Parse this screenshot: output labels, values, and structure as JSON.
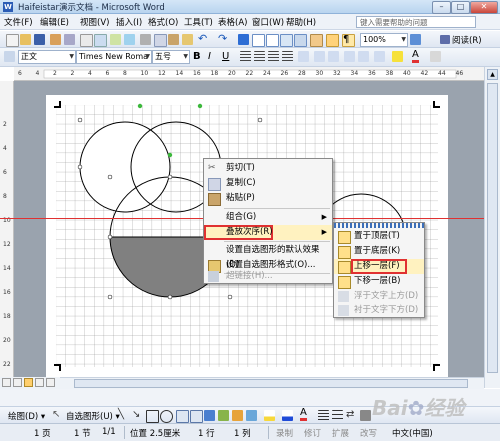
{
  "window": {
    "title": "Haifeistar演示文档 - Microsoft Word",
    "app_icon": "W",
    "minimize": "–",
    "maximize": "□",
    "close": "✕"
  },
  "menubar": {
    "items": [
      "文件(F)",
      "编辑(E)",
      "视图(V)",
      "插入(I)",
      "格式(O)",
      "工具(T)",
      "表格(A)",
      "窗口(W)",
      "帮助(H)"
    ],
    "help_placeholder": "键入需要帮助的问题"
  },
  "standard_toolbar": {
    "zoom": "100%",
    "reading_mode": "阅读(R)",
    "undo_icon": "undo-icon",
    "redo_icon": "redo-icon"
  },
  "format_toolbar": {
    "style": "正文",
    "font": "Times New Roma",
    "size": "五号",
    "bold": "B",
    "italic": "I",
    "underline": "U",
    "font_color_letter": "A"
  },
  "ruler": {
    "h_ticks": [
      "6",
      "4",
      "2",
      "2",
      "4",
      "6",
      "8",
      "10",
      "12",
      "14",
      "16",
      "18",
      "20",
      "22",
      "24",
      "26",
      "28",
      "30",
      "32",
      "34",
      "36",
      "38",
      "40",
      "42",
      "44",
      "46"
    ],
    "v_ticks": [
      "2",
      "4",
      "6",
      "8",
      "10",
      "12",
      "14",
      "16",
      "18",
      "20",
      "22"
    ]
  },
  "context_menu": {
    "items": [
      {
        "label": "剪切(T)",
        "icon": "scissors-icon",
        "disabled": false
      },
      {
        "label": "复制(C)",
        "icon": "copy-icon",
        "disabled": false
      },
      {
        "label": "粘贴(P)",
        "icon": "paste-icon",
        "disabled": false
      },
      {
        "label": "组合(G)",
        "icon": "",
        "disabled": false,
        "submenu": true
      },
      {
        "label": "叠放次序(R)",
        "icon": "",
        "disabled": false,
        "submenu": true,
        "highlighted": true
      },
      {
        "label": "设置自选图形的默认效果(D)",
        "icon": "",
        "disabled": false
      },
      {
        "label": "设置自选图形格式(O)...",
        "icon": "format-shape-icon",
        "disabled": false
      },
      {
        "label": "超链接(H)...",
        "icon": "hyperlink-icon",
        "disabled": true
      }
    ]
  },
  "submenu": {
    "items": [
      {
        "label": "置于顶层(T)",
        "icon": "bring-to-front-icon",
        "disabled": false
      },
      {
        "label": "置于底层(K)",
        "icon": "send-to-back-icon",
        "disabled": false
      },
      {
        "label": "上移一层(F)",
        "icon": "bring-forward-icon",
        "disabled": false,
        "highlighted": true
      },
      {
        "label": "下移一层(B)",
        "icon": "send-backward-icon",
        "disabled": false
      },
      {
        "label": "浮于文字上方(D)",
        "icon": "in-front-of-text-icon",
        "disabled": true
      },
      {
        "label": "衬于文字下方(D)",
        "icon": "behind-text-icon",
        "disabled": true
      }
    ]
  },
  "drawing_toolbar": {
    "draw": "绘图(D) ▾",
    "autoshapes": "自选图形(U) ▾"
  },
  "statusbar": {
    "page": "1 页",
    "section": "1 节",
    "page_of": "1/1",
    "position": "位置 2.5厘米",
    "line": "1 行",
    "column": "1 列",
    "rec": "录制",
    "trk": "修订",
    "ext": "扩展",
    "ovr": "改写",
    "language": "中文(中国)"
  },
  "colors": {
    "accent_red": "#e03131",
    "shape_fill_gray": "#808080",
    "menu_bg": "#f5f5f5",
    "highlight_bg": "#fff2c0"
  }
}
